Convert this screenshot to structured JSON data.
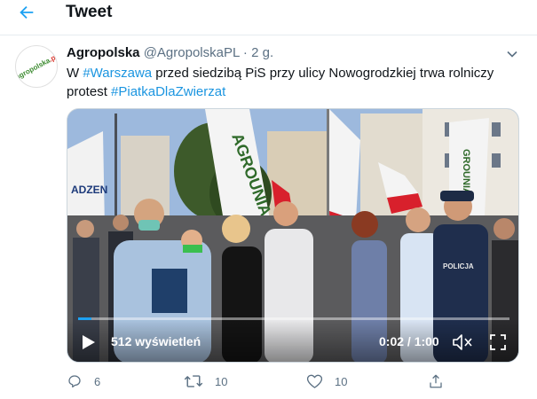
{
  "header": {
    "title": "Tweet",
    "back_icon": "arrow-left-icon"
  },
  "tweet": {
    "display_name": "Agropolska",
    "handle": "@AgropolskaPL",
    "separator": "·",
    "time": "2 g.",
    "avatar_text_main": "agropolska",
    "avatar_text_suffix": ".pl",
    "text_prefix": "W ",
    "hashtag_1": "#Warszawa",
    "text_middle": " przed siedzibą PiS przy ulicy Nowogrodzkiej trwa rolniczy protest ",
    "hashtag_2": "#PiatkaDlaZwierzat"
  },
  "video": {
    "views": "512 wyświetleń",
    "time": "0:02 / 1:00",
    "progress_fraction": 0.03,
    "banner_text": "AGROUNIA",
    "banner_text_2": "GROUNIA",
    "sign_text": "ADZEN",
    "police_text": "POLICJA"
  },
  "actions": {
    "reply_count": "6",
    "retweet_count": "10",
    "like_count": "10"
  },
  "colors": {
    "accent": "#1da1f2",
    "hashtag": "#1b95e0",
    "muted": "#5b7083"
  }
}
